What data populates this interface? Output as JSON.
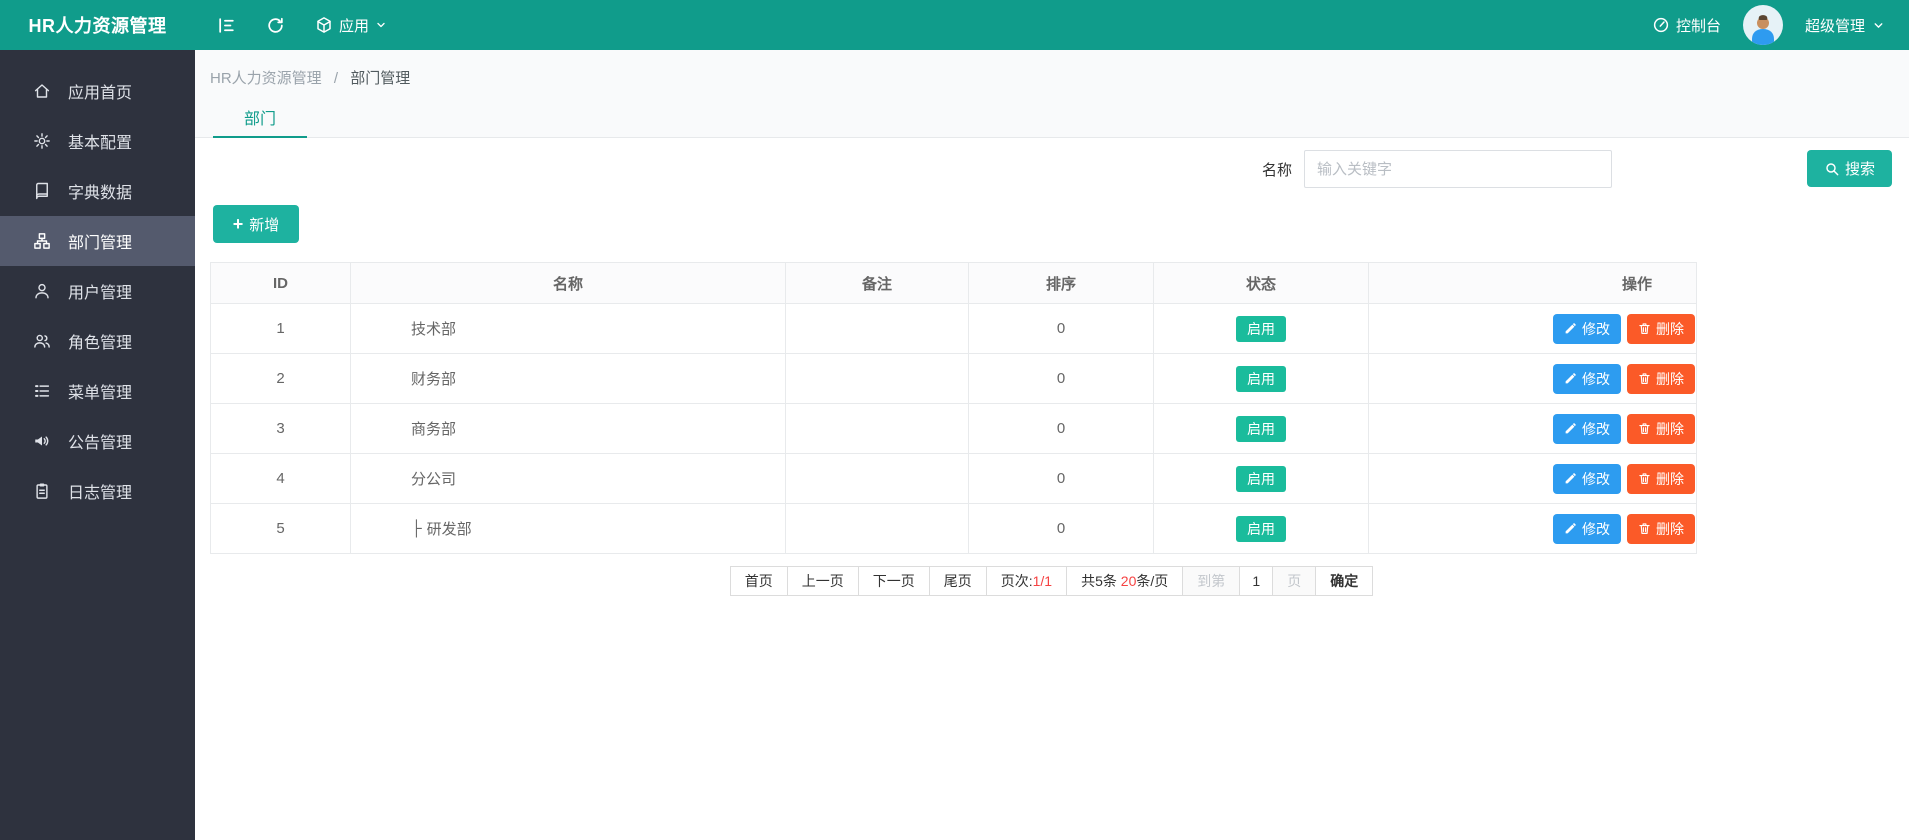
{
  "topbar": {
    "title": "HR人力资源管理",
    "app_label": "应用",
    "console_label": "控制台",
    "user_label": "超级管理"
  },
  "sidebar": {
    "items": [
      {
        "label": "应用首页",
        "icon": "home",
        "active": false
      },
      {
        "label": "基本配置",
        "icon": "gear",
        "active": false
      },
      {
        "label": "字典数据",
        "icon": "book",
        "active": false
      },
      {
        "label": "部门管理",
        "icon": "sitemap",
        "active": true
      },
      {
        "label": "用户管理",
        "icon": "user",
        "active": false
      },
      {
        "label": "角色管理",
        "icon": "users",
        "active": false
      },
      {
        "label": "菜单管理",
        "icon": "list",
        "active": false
      },
      {
        "label": "公告管理",
        "icon": "speaker",
        "active": false
      },
      {
        "label": "日志管理",
        "icon": "clipboard",
        "active": false
      }
    ]
  },
  "breadcrumb": {
    "root": "HR人力资源管理",
    "separator": "/",
    "current": "部门管理"
  },
  "tabs": {
    "active": "部门"
  },
  "filter": {
    "name_label": "名称",
    "keyword_placeholder": "输入关键字",
    "search_label": "搜索"
  },
  "toolbar": {
    "add_label": "新增"
  },
  "table": {
    "columns": [
      "ID",
      "名称",
      "备注",
      "排序",
      "状态",
      "操作"
    ],
    "action_edit": "修改",
    "action_delete": "删除",
    "rows": [
      {
        "id": "1",
        "name": "技术部",
        "remark": "",
        "sort": "0",
        "status": "启用"
      },
      {
        "id": "2",
        "name": "财务部",
        "remark": "",
        "sort": "0",
        "status": "启用"
      },
      {
        "id": "3",
        "name": "商务部",
        "remark": "",
        "sort": "0",
        "status": "启用"
      },
      {
        "id": "4",
        "name": "分公司",
        "remark": "",
        "sort": "0",
        "status": "启用"
      },
      {
        "id": "5",
        "name": "研发部",
        "prefix": "├",
        "remark": "",
        "sort": "0",
        "status": "启用"
      }
    ]
  },
  "pagination": {
    "first": "首页",
    "prev": "上一页",
    "next": "下一页",
    "last": "尾页",
    "page_label": "页次:",
    "page_value": "1/1",
    "total_label": "共5条",
    "size_value": "20",
    "size_suffix": "条/页",
    "goto_label": "到第",
    "goto_value": "1",
    "goto_suffix": "页",
    "confirm_label": "确定"
  },
  "colors": {
    "brand": "#109c8b",
    "accent_button": "#1eb2a0",
    "status_badge": "#1abc9c",
    "edit_button": "#2d9cf0",
    "delete_button": "#fb5a28",
    "sidebar_bg": "#2e323e",
    "sidebar_active": "#545a6d",
    "pager_red": "#f64242"
  }
}
